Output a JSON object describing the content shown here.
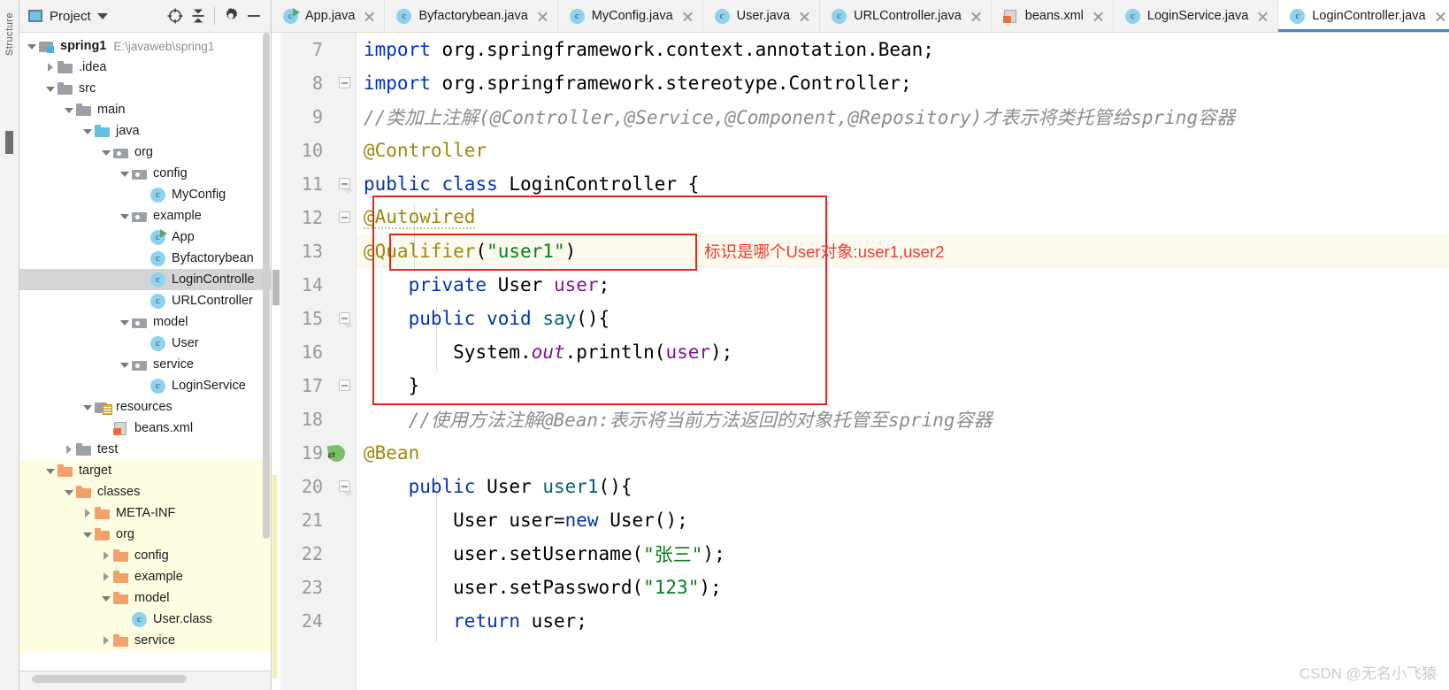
{
  "left_strip": {
    "label": "Structure",
    "mark": "scrollbar-mark"
  },
  "project_panel": {
    "header": {
      "title": "Project",
      "caret_icon": "chevron-down-icon",
      "locate_icon": "target-icon",
      "collapse_icon": "collapse-all-icon",
      "settings_icon": "gear-icon",
      "hide_icon": "minimize-icon"
    },
    "tree": [
      {
        "label": "spring1",
        "secondary": "E:\\javaweb\\spring1",
        "icon": "module-icon",
        "arrow": "down",
        "depth": 0,
        "bold": true,
        "state": "normal"
      },
      {
        "label": ".idea",
        "secondary": "",
        "icon": "folder-grey-icon",
        "arrow": "right",
        "depth": 1,
        "bold": false,
        "state": "normal"
      },
      {
        "label": "src",
        "secondary": "",
        "icon": "folder-grey-icon",
        "arrow": "down",
        "depth": 1,
        "bold": false,
        "state": "normal"
      },
      {
        "label": "main",
        "secondary": "",
        "icon": "folder-grey-icon",
        "arrow": "down",
        "depth": 2,
        "bold": false,
        "state": "normal"
      },
      {
        "label": "java",
        "secondary": "",
        "icon": "folder-blue-icon",
        "arrow": "down",
        "depth": 3,
        "bold": false,
        "state": "normal"
      },
      {
        "label": "org",
        "secondary": "",
        "icon": "package-icon",
        "arrow": "down",
        "depth": 4,
        "bold": false,
        "state": "normal"
      },
      {
        "label": "config",
        "secondary": "",
        "icon": "package-icon",
        "arrow": "down",
        "depth": 5,
        "bold": false,
        "state": "normal"
      },
      {
        "label": "MyConfig",
        "secondary": "",
        "icon": "java-class-icon",
        "arrow": "none",
        "depth": 6,
        "bold": false,
        "state": "normal"
      },
      {
        "label": "example",
        "secondary": "",
        "icon": "package-icon",
        "arrow": "down",
        "depth": 5,
        "bold": false,
        "state": "normal"
      },
      {
        "label": "App",
        "secondary": "",
        "icon": "java-class-runnable-icon",
        "arrow": "none",
        "depth": 6,
        "bold": false,
        "state": "normal"
      },
      {
        "label": "Byfactorybean",
        "secondary": "",
        "icon": "java-class-icon",
        "arrow": "none",
        "depth": 6,
        "bold": false,
        "state": "normal"
      },
      {
        "label": "LoginControlle",
        "secondary": "",
        "icon": "java-class-icon",
        "arrow": "none",
        "depth": 6,
        "bold": false,
        "state": "selected"
      },
      {
        "label": "URLController",
        "secondary": "",
        "icon": "java-class-icon",
        "arrow": "none",
        "depth": 6,
        "bold": false,
        "state": "normal"
      },
      {
        "label": "model",
        "secondary": "",
        "icon": "package-icon",
        "arrow": "down",
        "depth": 5,
        "bold": false,
        "state": "normal"
      },
      {
        "label": "User",
        "secondary": "",
        "icon": "java-class-icon",
        "arrow": "none",
        "depth": 6,
        "bold": false,
        "state": "normal"
      },
      {
        "label": "service",
        "secondary": "",
        "icon": "package-icon",
        "arrow": "down",
        "depth": 5,
        "bold": false,
        "state": "normal"
      },
      {
        "label": "LoginService",
        "secondary": "",
        "icon": "java-class-icon",
        "arrow": "none",
        "depth": 6,
        "bold": false,
        "state": "normal"
      },
      {
        "label": "resources",
        "secondary": "",
        "icon": "resources-root-icon",
        "arrow": "down",
        "depth": 3,
        "bold": false,
        "state": "normal"
      },
      {
        "label": "beans.xml",
        "secondary": "",
        "icon": "xml-file-icon",
        "arrow": "none",
        "depth": 4,
        "bold": false,
        "state": "normal"
      },
      {
        "label": "test",
        "secondary": "",
        "icon": "folder-grey-icon",
        "arrow": "right",
        "depth": 2,
        "bold": false,
        "state": "normal"
      },
      {
        "label": "target",
        "secondary": "",
        "icon": "folder-orange-icon",
        "arrow": "down",
        "depth": 1,
        "bold": false,
        "state": "excluded"
      },
      {
        "label": "classes",
        "secondary": "",
        "icon": "folder-orange-icon",
        "arrow": "down",
        "depth": 2,
        "bold": false,
        "state": "excluded"
      },
      {
        "label": "META-INF",
        "secondary": "",
        "icon": "folder-orange-icon",
        "arrow": "right",
        "depth": 3,
        "bold": false,
        "state": "excluded"
      },
      {
        "label": "org",
        "secondary": "",
        "icon": "folder-orange-icon",
        "arrow": "down",
        "depth": 3,
        "bold": false,
        "state": "excluded"
      },
      {
        "label": "config",
        "secondary": "",
        "icon": "folder-orange-icon",
        "arrow": "right",
        "depth": 4,
        "bold": false,
        "state": "excluded"
      },
      {
        "label": "example",
        "secondary": "",
        "icon": "folder-orange-icon",
        "arrow": "right",
        "depth": 4,
        "bold": false,
        "state": "excluded"
      },
      {
        "label": "model",
        "secondary": "",
        "icon": "folder-orange-icon",
        "arrow": "down",
        "depth": 4,
        "bold": false,
        "state": "excluded"
      },
      {
        "label": "User.class",
        "secondary": "",
        "icon": "java-class-icon",
        "arrow": "none",
        "depth": 5,
        "bold": false,
        "state": "excluded"
      },
      {
        "label": "service",
        "secondary": "",
        "icon": "folder-orange-icon",
        "arrow": "right",
        "depth": 4,
        "bold": false,
        "state": "excluded"
      }
    ]
  },
  "editor": {
    "tabs": [
      {
        "label": "App.java",
        "icon": "java-class-runnable-icon",
        "active": false
      },
      {
        "label": "Byfactorybean.java",
        "icon": "java-class-icon",
        "active": false
      },
      {
        "label": "MyConfig.java",
        "icon": "java-class-icon",
        "active": false
      },
      {
        "label": "User.java",
        "icon": "java-class-icon",
        "active": false
      },
      {
        "label": "URLController.java",
        "icon": "java-class-icon",
        "active": false
      },
      {
        "label": "beans.xml",
        "icon": "xml-file-icon",
        "active": false
      },
      {
        "label": "LoginService.java",
        "icon": "java-class-icon",
        "active": false
      },
      {
        "label": "LoginController.java",
        "icon": "java-class-icon",
        "active": true
      }
    ],
    "lines": [
      {
        "no": "7",
        "text": "import org.springframework.context.annotation.Bean;"
      },
      {
        "no": "8",
        "text": "import org.springframework.stereotype.Controller;"
      },
      {
        "no": "9",
        "text": "//类加上注解(@Controller,@Service,@Component,@Repository)才表示将类托管给spring容器"
      },
      {
        "no": "10",
        "text": "@Controller"
      },
      {
        "no": "11",
        "text": "public class LoginController {"
      },
      {
        "no": "12",
        "text": "    @Autowired"
      },
      {
        "no": "13",
        "text": "    @Qualifier(\"user1\")"
      },
      {
        "no": "14",
        "text": "    private User user;"
      },
      {
        "no": "15",
        "text": "    public void say(){"
      },
      {
        "no": "16",
        "text": "        System.out.println(user);"
      },
      {
        "no": "17",
        "text": "    }"
      },
      {
        "no": "18",
        "text": "    //使用方法注解@Bean:表示将当前方法返回的对象托管至spring容器"
      },
      {
        "no": "19",
        "text": "    @Bean"
      },
      {
        "no": "20",
        "text": "    public User user1(){"
      },
      {
        "no": "21",
        "text": "        User user=new User();"
      },
      {
        "no": "22",
        "text": "        user.setUsername(\"张三\");"
      },
      {
        "no": "23",
        "text": "        user.setPassword(\"123\");"
      },
      {
        "no": "24",
        "text": "        return user;"
      }
    ],
    "gutter_icons": {
      "bean_line": "19",
      "bean_icon": "spring-bean-icon"
    }
  },
  "annotations": {
    "note_text": "标识是哪个User对象:user1,user2",
    "box_color": "#e8261a",
    "note_color": "#ef3a2e"
  },
  "watermark": "CSDN @无名小飞猿"
}
